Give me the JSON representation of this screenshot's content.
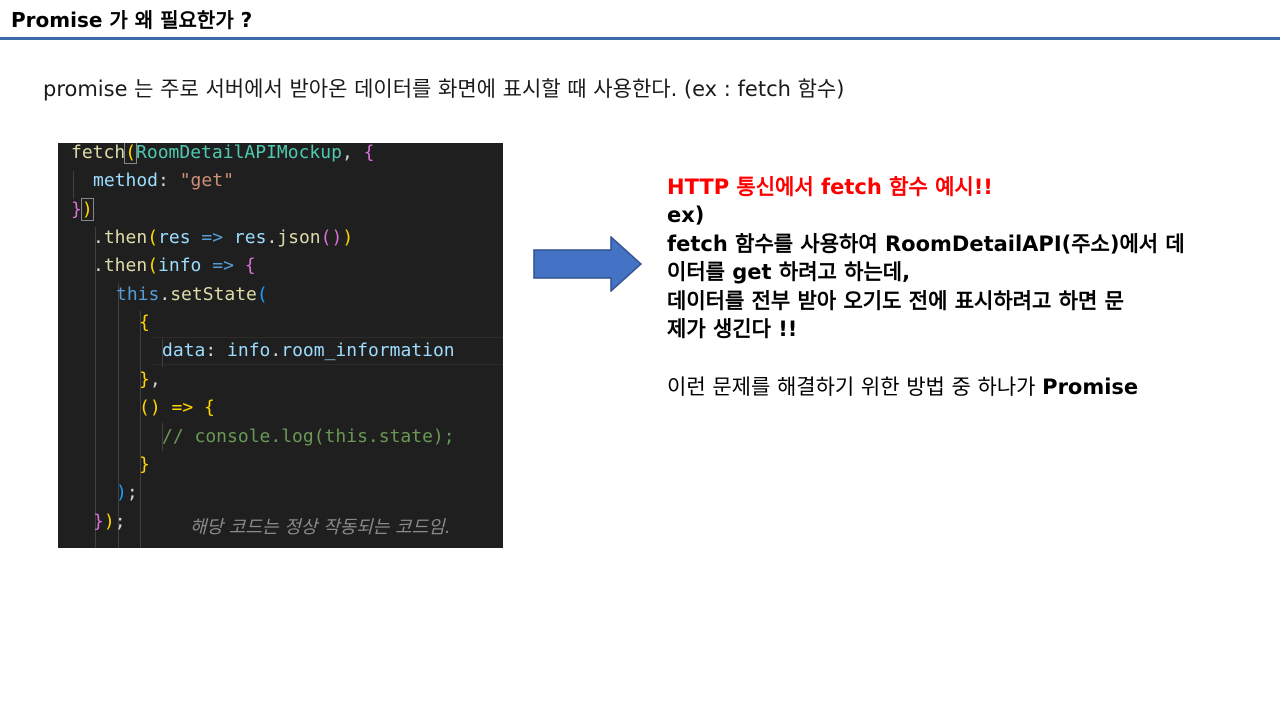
{
  "slide": {
    "title": "Promise 가 왜 필요한가 ?",
    "intro": "promise 는 주로 서버에서 받아온 데이터를 화면에 표시할 때 사용한다. (ex : fetch 함수)"
  },
  "code": {
    "tokens": {
      "fetch": "fetch",
      "open_paren": "(",
      "mockup": "RoomDetailAPIMockup",
      "comma_space": ", ",
      "open_brace": "{",
      "method": "method",
      "colon_space": ": ",
      "get_str": "\"get\"",
      "close_brace": "}",
      "close_paren": ")",
      "dot": ".",
      "then": "then",
      "res": "res",
      "arrow_op": " => ",
      "json": "json",
      "empty_parens": "()",
      "info": "info",
      "this": "this",
      "setState": "setState",
      "data_key": "data",
      "room_information": "room_information",
      "comma": ",",
      "arrow_empty": "() => {",
      "comment": "// console.log(this.state);",
      "semicolon": ";"
    },
    "note": "해당 코드는 정상 작동되는 코드임."
  },
  "arrow": {
    "icon": "right-arrow-icon",
    "fill": "#4472c4",
    "stroke": "#2f528f"
  },
  "explain": {
    "heading": "HTTP 통신에서 fetch 함수 예시!!",
    "lines": [
      "ex)",
      "fetch 함수를 사용하여 RoomDetailAPI(주소)에서 데",
      "이터를 get 하려고 하는데,",
      "데이터를 전부 받아 오기도 전에 표시하려고 하면 문",
      "제가 생긴다 !!"
    ],
    "conclusion_prefix": "이런 문제를 해결하기 위한 방법 중 하나가 ",
    "conclusion_keyword": "Promise"
  },
  "colors": {
    "title_rule": "#3e6aa8",
    "heading_red": "#ff0000",
    "code_background": "#1f1f1f"
  }
}
